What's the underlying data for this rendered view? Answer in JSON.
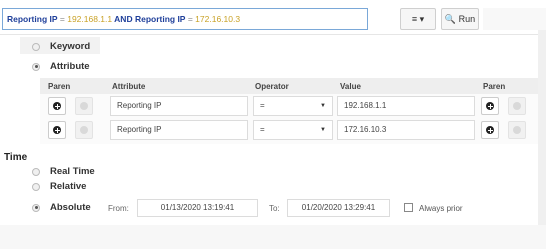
{
  "query": {
    "key1": "Reporting IP",
    "op1": " = ",
    "val1": "192.168.1.1",
    "and": " AND ",
    "key2": "Reporting IP",
    "op2": " = ",
    "val2": "172.16.10.3"
  },
  "toolbar": {
    "menu_label": "≡ ▾",
    "run_label": "🔍 Run"
  },
  "mode": {
    "keyword": "Keyword",
    "attribute": "Attribute"
  },
  "table": {
    "headers": {
      "paren_left": "Paren",
      "attribute": "Attribute",
      "operator": "Operator",
      "value": "Value",
      "paren_right": "Paren"
    },
    "rows": [
      {
        "attribute": "Reporting IP",
        "operator": "=",
        "value": "192.168.1.1"
      },
      {
        "attribute": "Reporting IP",
        "operator": "=",
        "value": "172.16.10.3"
      }
    ]
  },
  "time": {
    "title": "Time",
    "real_time": "Real Time",
    "relative": "Relative",
    "absolute": "Absolute",
    "from_label": "From:",
    "from_value": "01/13/2020 13:19:41",
    "to_label": "To:",
    "to_value": "01/20/2020 13:29:41",
    "always_prior": "Always prior"
  }
}
